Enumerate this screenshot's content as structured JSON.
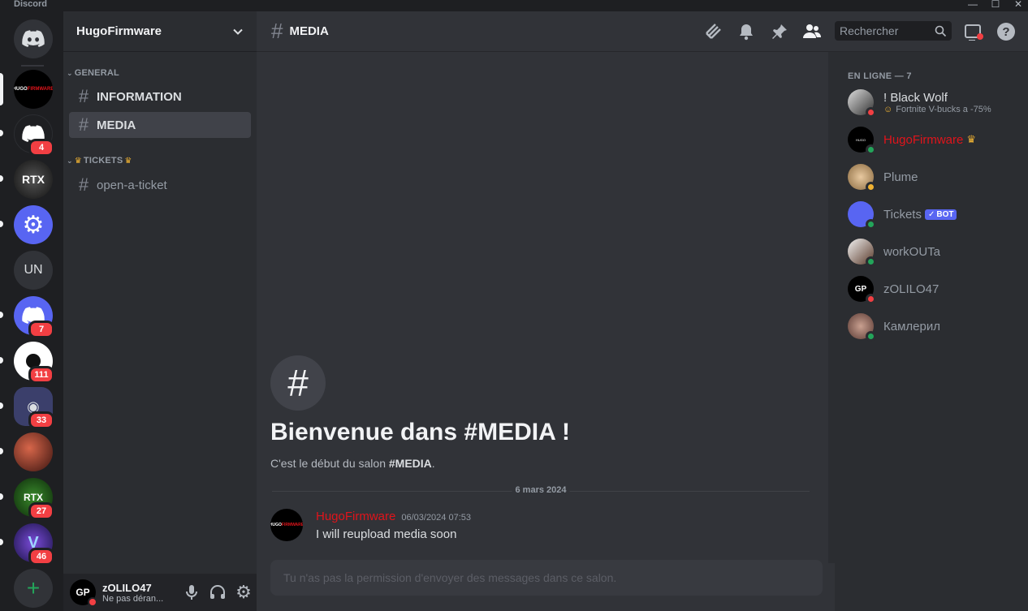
{
  "window": {
    "app_name": "Discord"
  },
  "servers": [
    {
      "name": "direct-messages",
      "icon": "discord-logo",
      "badge": ""
    },
    {
      "name": "HugoFirmware",
      "icon": "hugofirmware-logo",
      "badge": ""
    },
    {
      "name": "server-discord-1",
      "icon": "discord-logo",
      "badge": "4"
    },
    {
      "name": "server-rtx",
      "icon": "rtx-logo",
      "badge": ""
    },
    {
      "name": "server-gear",
      "icon": "gear-icon",
      "badge": ""
    },
    {
      "name": "UN",
      "label": "UN",
      "badge": ""
    },
    {
      "name": "server-discord-2",
      "icon": "discord-logo",
      "badge": "7"
    },
    {
      "name": "server-nc",
      "icon": "nc-logo",
      "badge": "111"
    },
    {
      "name": "server-folder",
      "icon": "folder-icon",
      "badge": "33"
    },
    {
      "name": "server-photo",
      "icon": "photo-icon",
      "badge": ""
    },
    {
      "name": "server-rtx-shop",
      "icon": "rtx-shop-logo",
      "badge": "27"
    },
    {
      "name": "server-v",
      "icon": "v-logo",
      "badge": "46"
    }
  ],
  "guild": {
    "name": "HugoFirmware",
    "categories": [
      {
        "label": "GENERAL",
        "channels": [
          "INFORMATION",
          "MEDIA"
        ]
      },
      {
        "label": "TICKETS",
        "channels": [
          "open-a-ticket"
        ]
      }
    ]
  },
  "user": {
    "name": "zOLILO47",
    "status": "Ne pas déran..."
  },
  "channel": {
    "name": "MEDIA",
    "search_placeholder": "Rechercher",
    "welcome_title": "Bienvenue dans #MEDIA !",
    "welcome_sub_prefix": "C'est le début du salon ",
    "welcome_sub_channel": "#MEDIA",
    "welcome_sub_suffix": ".",
    "date_divider": "6 mars 2024",
    "message": {
      "author": "HugoFirmware",
      "timestamp": "06/03/2024 07:53",
      "text": "I will reupload media soon"
    },
    "composer_placeholder": "Tu n'as pas la permission d'envoyer des messages dans ce salon."
  },
  "members": {
    "category": "EN LIGNE — 7",
    "list": [
      {
        "name": "! Black Wolf",
        "status_text": "Fortnite V-bucks a -75%",
        "state": "dnd"
      },
      {
        "name": "HugoFirmware",
        "state": "online",
        "owner": true
      },
      {
        "name": "Plume",
        "state": "idle"
      },
      {
        "name": "Tickets",
        "state": "online",
        "bot": "BOT"
      },
      {
        "name": "workOUTa",
        "state": "online"
      },
      {
        "name": "zOLILO47",
        "state": "dnd"
      },
      {
        "name": "Камлерил",
        "state": "online"
      }
    ]
  },
  "colors": {
    "accent": "#5865f2",
    "owner": "#e0141b",
    "online": "#23a55a",
    "dnd": "#f23f43",
    "idle": "#f0b232"
  }
}
